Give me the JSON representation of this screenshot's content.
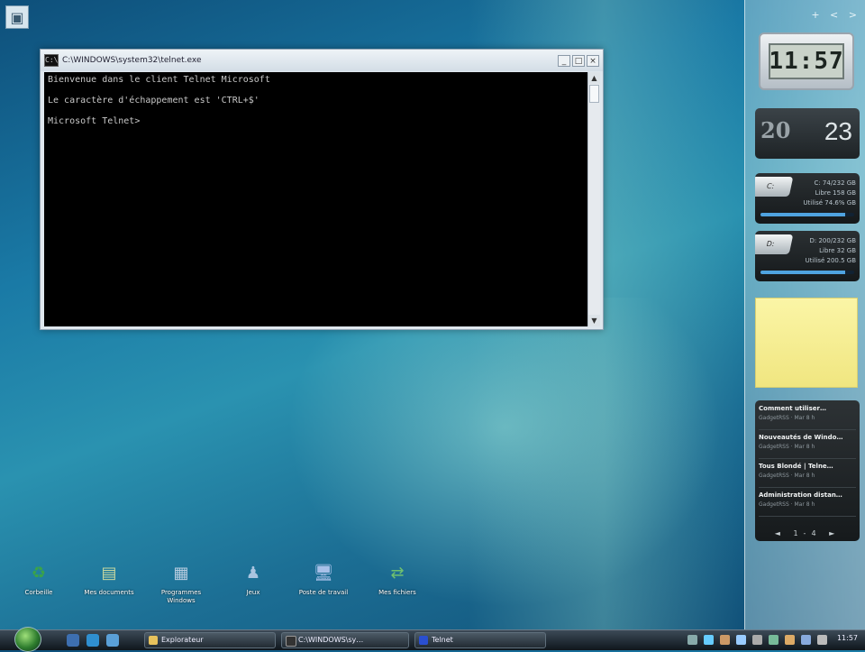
{
  "console": {
    "title": "C:\\WINDOWS\\system32\\telnet.exe",
    "lines": [
      "Bienvenue dans le client Telnet Microsoft",
      "Le caractère d'échappement est 'CTRL+$'",
      "Microsoft Telnet>"
    ],
    "minimize": "_",
    "maximize": "□",
    "close": "×",
    "app_icon_text": "C:\\"
  },
  "sidebar": {
    "controls": "+ < >",
    "clock": {
      "time": "11:57"
    },
    "calendar": {
      "month_text": "20",
      "day": "23"
    },
    "drives": [
      {
        "label": "C:",
        "line1": "C: 74/232 GB",
        "line2": "Libre 158 GB",
        "line3": "Utilisé 74.6% GB",
        "usage": 0.9
      },
      {
        "label": "D:",
        "line1": "D: 200/232 GB",
        "line2": "Libre 32 GB",
        "line3": "Utilisé 200.5 GB",
        "usage": 0.9
      }
    ],
    "feeds": [
      {
        "title": "Comment  utiliser…",
        "sub": "GadgetRSS  ·  Mar 8 h"
      },
      {
        "title": "Nouveautés de Windo…",
        "sub": "GadgetRSS  ·  Mar 8 h"
      },
      {
        "title": "Tous Blondé | Telne…",
        "sub": "GadgetRSS  ·  Mar 8 h"
      },
      {
        "title": "Administration distan…",
        "sub": "GadgetRSS  ·  Mar 8 h"
      }
    ],
    "feed_nav": "◄ 1-4 ►"
  },
  "desktop_icons": [
    {
      "label": "Corbeille",
      "icon": "recycle-bin-icon",
      "glyph": "♻",
      "color": "#3aa34a"
    },
    {
      "label": "Mes documents",
      "icon": "documents-icon",
      "glyph": "▤",
      "color": "#c7d8a0"
    },
    {
      "label": "Programmes Windows",
      "icon": "programs-icon",
      "glyph": "▦",
      "color": "#b9cde0"
    },
    {
      "label": "Jeux",
      "icon": "games-icon",
      "glyph": "♟",
      "color": "#a9c4e0"
    },
    {
      "label": "Poste de travail",
      "icon": "computer-icon",
      "glyph": "🖥",
      "color": "#a8c0e8"
    },
    {
      "label": "Mes fichiers",
      "icon": "network-icon",
      "glyph": "⇄",
      "color": "#6fc06f"
    }
  ],
  "taskbar": {
    "buttons": [
      {
        "label": "Explorateur",
        "color": "#e7c25c"
      },
      {
        "label": "C:\\WINDOWS\\sy…",
        "color": "#333"
      },
      {
        "label": "Telnet",
        "color": "#2a4fd0"
      }
    ],
    "clock": "11:57"
  },
  "colors": {
    "accent": "#4fa3e0",
    "console_bg": "#000000",
    "note": "#f6ed92"
  }
}
